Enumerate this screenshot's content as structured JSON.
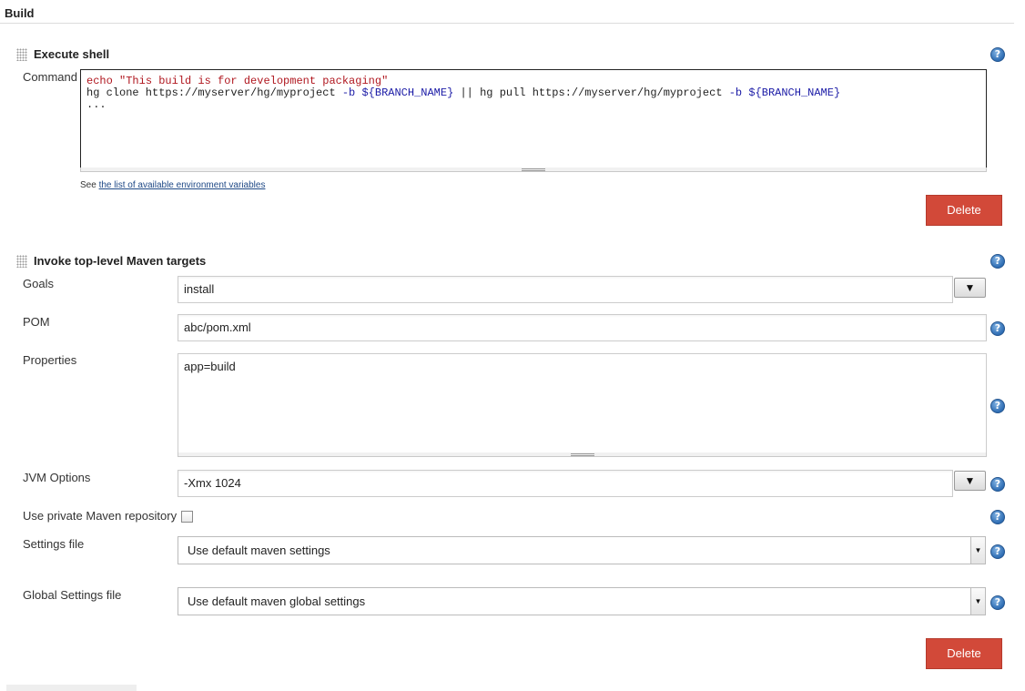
{
  "section": {
    "title": "Build"
  },
  "execute_shell": {
    "title": "Execute shell",
    "command_label": "Command",
    "command_lines": [
      [
        {
          "t": "echo ",
          "c": "red"
        },
        {
          "t": "\"This build is for development packaging\"",
          "c": "red"
        }
      ],
      [
        {
          "t": "hg clone https://myserver/hg/myproject ",
          "c": ""
        },
        {
          "t": "-b ${BRANCH_NAME}",
          "c": "blue"
        },
        {
          "t": " || hg pull https://myserver/hg/myproject ",
          "c": ""
        },
        {
          "t": "-b ${BRANCH_NAME}",
          "c": "blue"
        }
      ],
      [
        {
          "t": "...",
          "c": ""
        }
      ]
    ],
    "env_note_prefix": "See ",
    "env_note_link": "the list of available environment variables",
    "delete_label": "Delete"
  },
  "maven": {
    "title": "Invoke top-level Maven targets",
    "goals_label": "Goals",
    "goals_value": "install",
    "dropdown_glyph": "▼",
    "pom_label": "POM",
    "pom_value": "abc/pom.xml",
    "properties_label": "Properties",
    "properties_value": "app=build",
    "jvm_label": "JVM Options",
    "jvm_value": "-Xmx 1024",
    "private_repo_label": "Use private Maven repository",
    "private_repo_checked": false,
    "settings_label": "Settings file",
    "settings_value": "Use default maven settings",
    "global_settings_label": "Global Settings file",
    "global_settings_value": "Use default maven global settings",
    "delete_label": "Delete"
  },
  "colors": {
    "delete_button": "#d24939",
    "help_icon": "#2e6db4",
    "code_red": "#b0171f",
    "code_blue": "#1a1aa6"
  },
  "icons": {
    "help": "help-icon",
    "drag_handle": "drag-handle-icon",
    "dropdown": "chevron-down-icon"
  }
}
